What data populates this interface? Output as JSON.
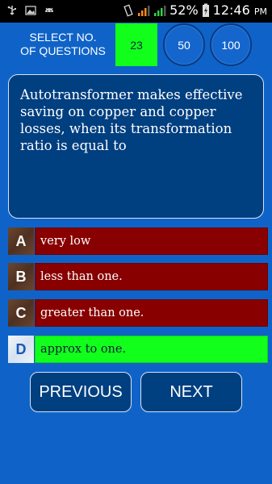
{
  "status_bar": {
    "icons": [
      "usb-icon",
      "image-icon",
      "android-icon",
      "vibrate-icon",
      "signal-icon",
      "signal-icon",
      "battery-charging-icon"
    ],
    "battery": "52%",
    "time": "12:46",
    "ampm": "PM"
  },
  "selector": {
    "label_line1": "SELECT NO.",
    "label_line2": "OF QUESTIONS",
    "current": "23",
    "options": [
      "50",
      "100"
    ]
  },
  "question": {
    "text": "Autotransformer makes effective saving on copper and copper losses, when its transformation ratio is equal to"
  },
  "options": [
    {
      "letter": "A",
      "text": "very low",
      "state": "default"
    },
    {
      "letter": "B",
      "text": "less than one.",
      "state": "default"
    },
    {
      "letter": "C",
      "text": "greater than one.",
      "state": "default"
    },
    {
      "letter": "D",
      "text": "approx to one.",
      "state": "correct"
    }
  ],
  "nav": {
    "previous_label": "PREVIOUS",
    "next_label": "NEXT"
  },
  "colors": {
    "background": "#0f63c8",
    "question_box": "#003f80",
    "option_default": "#880000",
    "option_correct": "#12ff1c"
  }
}
